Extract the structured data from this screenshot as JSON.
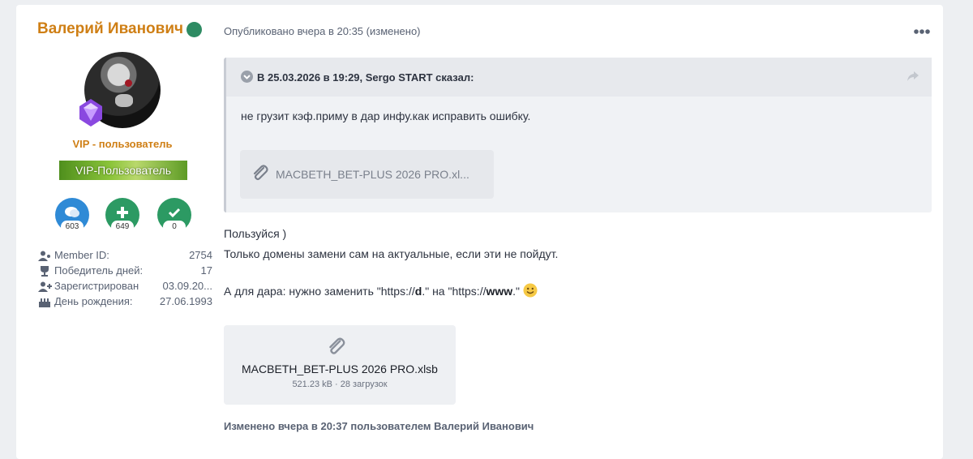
{
  "author": {
    "name": "Валерий Иванович",
    "title": "VIP - пользователь",
    "badge": "VIP-Пользователь",
    "stats": [
      {
        "icon": "comments-icon",
        "count": "603"
      },
      {
        "icon": "plus-icon",
        "count": "649"
      },
      {
        "icon": "check-icon",
        "count": "0"
      }
    ],
    "info": [
      {
        "icon": "user-icon",
        "label": "Member ID:",
        "value": "2754"
      },
      {
        "icon": "trophy-icon",
        "label": "Победитель дней:",
        "value": "17"
      },
      {
        "icon": "user-plus-icon",
        "label": "Зарегистрирован",
        "value": "03.09.20..."
      },
      {
        "icon": "birthday-cake-icon",
        "label": "День рождения:",
        "value": "27.06.1993"
      }
    ]
  },
  "post": {
    "meta": "Опубликовано вчера в 20:35 (изменено)",
    "quote": {
      "cite": "В 25.03.2026 в 19:29, Sergo START сказал:",
      "text": "не грузит кэф.приму в дар инфу.как исправить ошибку.",
      "file": "MACBETH_BET-PLUS 2026 PRO.xl..."
    },
    "line1": "Пользуйся )",
    "line2": "Только домены замени сам на актуальные, если эти не пойдут.",
    "line3_a": "А для дара: нужно заменить \"https://",
    "line3_b": "d",
    "line3_c": ".\" на \"https://",
    "line3_d": "www",
    "line3_e": ".\"",
    "attachment": {
      "name": "MACBETH_BET-PLUS 2026 PRO.xlsb",
      "meta": "521.23 kB · 28 загрузок"
    },
    "edited": "Изменено вчера в 20:37 пользователем Валерий Иванович"
  },
  "colors": {
    "username": "#cf7f15",
    "online": "#2e8b63",
    "accent_blue": "#2f8ad6",
    "accent_green": "#2c9a63"
  }
}
